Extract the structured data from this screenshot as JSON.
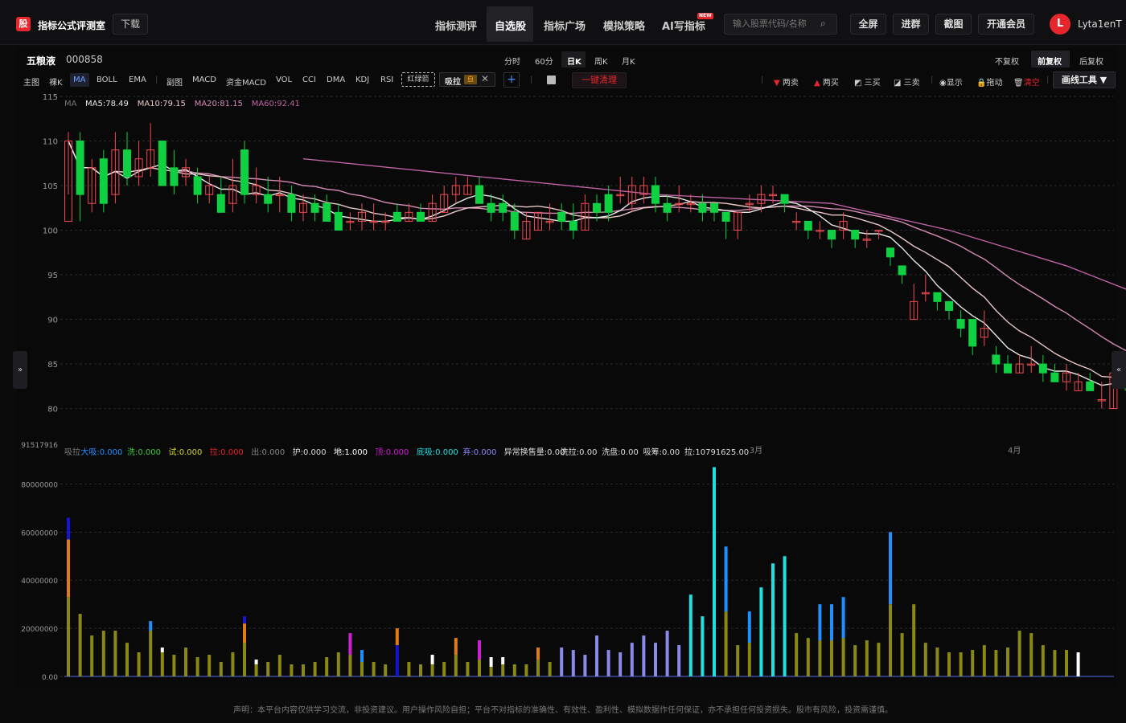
{
  "app": {
    "logo_text": "股",
    "title": "指标公式评测室",
    "download": "下载"
  },
  "nav": [
    "指标测评",
    "自选股",
    "指标广场",
    "模拟策略",
    "AI写指标"
  ],
  "nav_badge": "NEW",
  "search": {
    "placeholder": "输入股票代码/名称"
  },
  "top_buttons": [
    "全屏",
    "进群",
    "截图",
    "开通会员"
  ],
  "user": {
    "initial": "L",
    "name": "Lyta1enT"
  },
  "stock": {
    "name": "五粮液",
    "code": "000858"
  },
  "periods": [
    "分时",
    "60分",
    "日K",
    "周K",
    "月K"
  ],
  "period_active": "日K",
  "adjust": [
    "不复权",
    "前复权",
    "后复权"
  ],
  "adjust_active": "前复权",
  "indicators_main": [
    "主图",
    "裸K",
    "MA",
    "BOLL",
    "EMA"
  ],
  "indicators_sub": [
    "副图",
    "MACD",
    "资金MACD",
    "VOL",
    "CCI",
    "DMA",
    "KDJ",
    "RSI"
  ],
  "red_green": "红绿箭",
  "xila": {
    "label": "吸拉",
    "tag": "自"
  },
  "clear_label": "一键清理",
  "actions": [
    "两卖",
    "两买",
    "三买",
    "三卖",
    "显示",
    "拖动",
    "清空"
  ],
  "draw_tool": "画线工具 ▼",
  "disclaimer": "声明：本平台内容仅供学习交流，非投资建议。用户操作风险自担；平台不对指标的准确性、有效性、盈利性、模拟数据作任何保证，亦不承担任何投资损失。股市有风险，投资需谨慎。",
  "colors": {
    "up": "#f04a50",
    "down": "#0fd040",
    "accent": "#e8262d"
  },
  "chart_data": {
    "type": "candlestick",
    "price_axis": {
      "ylim": [
        76,
        115
      ],
      "ticks": [
        115,
        110,
        105,
        100,
        95,
        90,
        85,
        80
      ]
    },
    "ma_legend": {
      "name": "MA",
      "items": [
        {
          "label": "MA5:78.49",
          "color": "#e8e8e8"
        },
        {
          "label": "MA10:79.15",
          "color": "#e9c7c7"
        },
        {
          "label": "MA20:81.15",
          "color": "#d68ab5"
        },
        {
          "label": "MA60:92.41",
          "color": "#c062a6"
        }
      ]
    },
    "candles": [
      [
        101,
        110,
        101,
        111,
        104
      ],
      [
        110,
        104,
        100,
        111,
        101
      ],
      [
        103,
        107,
        104,
        108,
        102
      ],
      [
        108,
        103,
        102,
        109,
        102
      ],
      [
        104,
        109,
        105,
        111,
        103
      ],
      [
        109,
        106,
        106,
        111,
        105
      ],
      [
        106,
        108,
        107,
        110,
        105
      ],
      [
        107,
        109,
        107,
        112,
        106
      ],
      [
        110,
        105,
        106,
        110,
        105
      ],
      [
        107,
        105,
        104,
        109,
        104
      ],
      [
        106,
        107,
        106,
        108,
        105
      ],
      [
        106,
        104,
        105,
        107,
        103
      ],
      [
        104,
        105,
        106,
        106,
        103
      ],
      [
        104,
        102,
        103,
        106,
        102
      ],
      [
        103,
        105,
        105,
        108,
        102
      ],
      [
        109,
        104,
        104,
        110,
        103
      ],
      [
        104,
        105,
        105,
        107,
        103
      ],
      [
        104,
        103,
        103,
        106,
        102
      ],
      [
        104,
        104,
        103,
        106,
        102
      ],
      [
        104,
        102,
        102,
        105,
        101
      ],
      [
        102,
        103,
        103,
        104,
        101
      ],
      [
        103,
        102,
        102,
        104,
        101
      ],
      [
        103,
        101,
        102,
        104,
        101
      ],
      [
        102,
        100,
        101,
        103,
        100
      ],
      [
        101,
        101,
        102,
        102,
        100
      ],
      [
        101,
        102,
        102,
        103,
        100
      ],
      [
        101,
        101,
        101,
        103,
        100
      ],
      [
        101,
        101,
        102,
        102,
        100
      ],
      [
        102,
        101,
        102,
        103,
        101
      ],
      [
        101,
        102,
        101,
        103,
        101
      ],
      [
        102,
        101,
        102,
        103,
        101
      ],
      [
        101,
        103,
        102,
        104,
        101
      ],
      [
        102,
        104,
        103,
        105,
        102
      ],
      [
        104,
        105,
        105,
        106,
        103
      ],
      [
        104,
        105,
        105,
        106,
        104
      ],
      [
        105,
        103,
        104,
        106,
        103
      ],
      [
        103,
        102,
        103,
        104,
        101
      ],
      [
        103,
        102,
        102,
        104,
        101
      ],
      [
        102,
        100,
        100,
        103,
        99
      ],
      [
        99,
        101,
        101,
        102,
        99
      ],
      [
        100,
        102,
        102,
        102,
        100
      ],
      [
        101,
        101,
        101,
        103,
        100
      ],
      [
        102,
        101,
        102,
        103,
        100
      ],
      [
        101,
        100,
        100,
        103,
        99
      ],
      [
        100,
        103,
        102,
        104,
        100
      ],
      [
        103,
        102,
        102,
        104,
        101
      ],
      [
        104,
        102,
        103,
        105,
        101
      ],
      [
        104,
        104,
        105,
        106,
        103
      ],
      [
        103,
        105,
        104,
        106,
        102
      ],
      [
        104,
        105,
        104,
        106,
        103
      ],
      [
        105,
        103,
        104,
        106,
        102
      ],
      [
        103,
        102,
        103,
        104,
        101
      ],
      [
        103,
        103,
        103,
        105,
        102
      ],
      [
        103,
        103,
        104,
        104,
        102
      ],
      [
        103,
        102,
        103,
        104,
        101
      ],
      [
        103,
        102,
        102,
        103,
        101
      ],
      [
        102,
        101,
        101,
        102,
        99
      ],
      [
        100,
        102,
        101,
        102,
        99
      ],
      [
        103,
        103,
        103,
        104,
        102
      ],
      [
        103,
        104,
        104,
        105,
        102
      ],
      [
        104,
        104,
        104,
        105,
        103
      ],
      [
        104,
        103,
        104,
        104,
        102
      ],
      [
        101,
        101,
        101,
        102,
        100
      ],
      [
        101,
        100,
        100,
        101,
        99
      ],
      [
        100,
        100,
        100,
        101,
        99
      ],
      [
        100,
        99,
        99,
        100,
        98
      ],
      [
        100,
        101,
        100,
        102,
        99
      ],
      [
        100,
        99,
        99,
        100,
        98
      ],
      [
        99,
        99,
        99,
        100,
        98
      ],
      [
        100,
        100,
        99,
        100,
        99
      ],
      [
        98,
        97,
        97,
        98,
        96
      ],
      [
        96,
        95,
        95,
        96,
        94
      ],
      [
        90,
        92,
        92,
        94,
        90
      ],
      [
        93,
        93,
        92,
        95,
        92
      ],
      [
        93,
        92,
        92,
        93,
        91
      ],
      [
        92,
        91,
        91,
        92,
        90
      ],
      [
        90,
        89,
        89,
        91,
        88
      ],
      [
        90,
        87,
        88,
        90,
        86
      ],
      [
        88,
        89,
        88,
        91,
        87
      ],
      [
        86,
        85,
        86,
        87,
        84
      ],
      [
        85,
        84,
        85,
        86,
        84
      ],
      [
        84,
        85,
        85,
        86,
        84
      ],
      [
        85,
        85,
        85,
        87,
        84
      ],
      [
        85,
        84,
        84,
        86,
        83
      ],
      [
        84,
        83,
        84,
        85,
        83
      ],
      [
        83,
        84,
        83,
        85,
        82
      ],
      [
        82,
        83,
        83,
        84,
        82
      ],
      [
        83,
        82,
        82,
        84,
        82
      ],
      [
        81,
        81,
        81,
        83,
        80
      ],
      [
        80,
        84,
        83,
        85,
        80
      ],
      [
        84,
        83,
        83,
        84,
        82
      ],
      [
        83,
        82,
        82,
        84,
        82
      ],
      [
        82,
        82,
        82,
        83,
        81
      ],
      [
        82,
        81,
        81,
        82,
        80
      ],
      [
        81,
        80,
        80,
        82,
        80
      ],
      [
        80,
        79,
        79,
        81,
        79
      ],
      [
        79,
        78,
        78,
        80,
        77
      ],
      [
        78,
        79,
        79,
        80,
        77
      ],
      [
        79,
        79,
        79,
        80,
        78
      ],
      [
        79,
        78,
        78,
        80,
        77
      ]
    ],
    "ma60": [
      [
        20,
        108
      ],
      [
        35,
        106
      ],
      [
        50,
        104
      ],
      [
        65,
        103
      ],
      [
        75,
        100
      ],
      [
        85,
        96
      ],
      [
        92,
        92.4
      ]
    ],
    "time_labels": [
      {
        "index": 58,
        "label": "3月"
      },
      {
        "index": 80,
        "label": "4月"
      }
    ],
    "volume_axis": {
      "ylim": [
        0,
        91517916
      ],
      "max_label": "91517916",
      "ticks": [
        0,
        20000000,
        40000000,
        60000000,
        80000000
      ],
      "tick_labels": [
        "0.00",
        "20000000",
        "40000000",
        "60000000",
        "80000000"
      ]
    },
    "xila_legend": [
      {
        "label": "吸拉",
        "color": "#7b7b7b"
      },
      {
        "label": "大吸:0.000",
        "color": "#1e90ff"
      },
      {
        "label": "洗:0.000",
        "color": "#3fc840"
      },
      {
        "label": "试:0.000",
        "color": "#d4d41a"
      },
      {
        "label": "拉:0.000",
        "color": "#e8262d"
      },
      {
        "label": "出:0.000",
        "color": "#888888"
      },
      {
        "label": "护:0.000",
        "color": "#dddddd"
      },
      {
        "label": "地:1.000",
        "color": "#ffffff"
      },
      {
        "label": "顶:0.000",
        "color": "#d21ed2"
      },
      {
        "label": "底吸:0.000",
        "color": "#1ee0e0"
      },
      {
        "label": "弃:0.000",
        "color": "#8a8aff"
      },
      {
        "label": "异常换售量:0.00",
        "color": "#dddddd"
      },
      {
        "label": "洗拉:0.00",
        "color": "#dddddd"
      },
      {
        "label": "洗盘:0.00",
        "color": "#dddddd"
      },
      {
        "label": "吸筹:0.00",
        "color": "#dddddd"
      },
      {
        "label": "拉:10791625.00",
        "color": "#dddddd"
      }
    ],
    "volume": [
      [
        33000000,
        "#8a8a12",
        24000000,
        "#e07d12",
        9000000,
        "#1414d2"
      ],
      [
        26000000,
        "#8a8a12"
      ],
      [
        17000000,
        "#8a8a12"
      ],
      [
        19000000,
        "#8a8a12"
      ],
      [
        19000000,
        "#8a8a12"
      ],
      [
        14000000,
        "#8a8a12"
      ],
      [
        10000000,
        "#8a8a12"
      ],
      [
        19000000,
        "#8a8a12",
        4000000,
        "#1e90ff"
      ],
      [
        10000000,
        "#8a8a12",
        2000000,
        "#ffffff"
      ],
      [
        9000000,
        "#8a8a12"
      ],
      [
        12000000,
        "#8a8a12"
      ],
      [
        8000000,
        "#8a8a12"
      ],
      [
        9000000,
        "#8a8a12"
      ],
      [
        6000000,
        "#8a8a12"
      ],
      [
        10000000,
        "#8a8a12"
      ],
      [
        14000000,
        "#8a8a12",
        8000000,
        "#e07d12",
        3000000,
        "#1414d2"
      ],
      [
        5000000,
        "#8a8a12",
        2000000,
        "#ffffff"
      ],
      [
        6000000,
        "#8a8a12"
      ],
      [
        9000000,
        "#8a8a12"
      ],
      [
        5000000,
        "#8a8a12"
      ],
      [
        5000000,
        "#8a8a12"
      ],
      [
        6000000,
        "#8a8a12"
      ],
      [
        8000000,
        "#8a8a12"
      ],
      [
        10000000,
        "#8a8a12"
      ],
      [
        9000000,
        "#8a8a12",
        9000000,
        "#d21ed2"
      ],
      [
        6000000,
        "#8a8a12",
        5000000,
        "#1e90ff"
      ],
      [
        6000000,
        "#8a8a12"
      ],
      [
        5000000,
        "#8a8a12"
      ],
      [
        13000000,
        "#1414d2",
        7000000,
        "#e07d12"
      ],
      [
        6000000,
        "#8a8a12"
      ],
      [
        5000000,
        "#8a8a12"
      ],
      [
        5000000,
        "#8a8a12",
        4000000,
        "#ffffff"
      ],
      [
        6000000,
        "#8a8a12"
      ],
      [
        9000000,
        "#8a8a12",
        7000000,
        "#e07d12"
      ],
      [
        6000000,
        "#8a8a12"
      ],
      [
        7000000,
        "#8a8a12",
        8000000,
        "#d21ed2"
      ],
      [
        4000000,
        "#8a8a12",
        4000000,
        "#ffffff"
      ],
      [
        5000000,
        "#8a8a12",
        3000000,
        "#ffffff"
      ],
      [
        5000000,
        "#8a8a12"
      ],
      [
        5000000,
        "#8a8a12"
      ],
      [
        7000000,
        "#8a8a12",
        5000000,
        "#e07d12"
      ],
      [
        6000000,
        "#8a8a12"
      ],
      [
        12000000,
        "#8a8ae8"
      ],
      [
        11000000,
        "#8a8ae8"
      ],
      [
        9000000,
        "#8a8ae8"
      ],
      [
        17000000,
        "#8a8ae8"
      ],
      [
        11000000,
        "#8a8ae8"
      ],
      [
        10000000,
        "#8a8ae8"
      ],
      [
        14000000,
        "#8a8ae8"
      ],
      [
        17000000,
        "#8a8ae8"
      ],
      [
        14000000,
        "#8a8ae8"
      ],
      [
        19000000,
        "#8a8ae8"
      ],
      [
        13000000,
        "#8a8ae8"
      ],
      [
        34000000,
        "#1ee0e0"
      ],
      [
        25000000,
        "#1ee0e0"
      ],
      [
        87000000,
        "#1ee0e0"
      ],
      [
        27000000,
        "#8a8a12",
        27000000,
        "#1e90ff"
      ],
      [
        13000000,
        "#8a8a12"
      ],
      [
        14000000,
        "#8a8a12",
        13000000,
        "#1e90ff"
      ],
      [
        37000000,
        "#1ee0e0"
      ],
      [
        47000000,
        "#1ee0e0"
      ],
      [
        50000000,
        "#1ee0e0"
      ],
      [
        18000000,
        "#8a8a12"
      ],
      [
        16000000,
        "#8a8a12"
      ],
      [
        15000000,
        "#8a8a12",
        15000000,
        "#1e90ff"
      ],
      [
        15000000,
        "#8a8a12",
        15000000,
        "#1e90ff"
      ],
      [
        16000000,
        "#8a8a12",
        17000000,
        "#1e90ff"
      ],
      [
        13000000,
        "#8a8a12"
      ],
      [
        15000000,
        "#8a8a12"
      ],
      [
        14000000,
        "#8a8a12"
      ],
      [
        30000000,
        "#8a8a12",
        30000000,
        "#1e90ff"
      ],
      [
        18000000,
        "#8a8a12"
      ],
      [
        30000000,
        "#8a8a12"
      ],
      [
        14000000,
        "#8a8a12"
      ],
      [
        12000000,
        "#8a8a12"
      ],
      [
        10000000,
        "#8a8a12"
      ],
      [
        10000000,
        "#8a8a12"
      ],
      [
        11000000,
        "#8a8a12"
      ],
      [
        13000000,
        "#8a8a12"
      ],
      [
        11000000,
        "#8a8a12"
      ],
      [
        12000000,
        "#8a8a12"
      ],
      [
        19000000,
        "#8a8a12"
      ],
      [
        18000000,
        "#8a8a12"
      ],
      [
        13000000,
        "#8a8a12"
      ],
      [
        11000000,
        "#8a8a12"
      ],
      [
        11000000,
        "#8a8a12"
      ],
      [
        10000000,
        "#ffffff"
      ]
    ]
  }
}
